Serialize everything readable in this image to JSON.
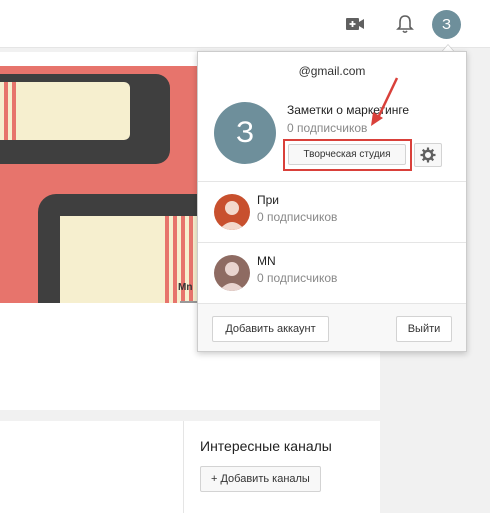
{
  "topbar": {
    "icons": [
      "video-upload-icon",
      "bell-icon"
    ],
    "avatar_letter": "З"
  },
  "banner": {
    "partial_label": "Mn"
  },
  "right_sidebar": {
    "title": "Интересные каналы",
    "add_button": "+ Добавить каналы"
  },
  "popup": {
    "email": "@gmail.com",
    "current_account": {
      "letter": "З",
      "name": "Заметки о маркетинге",
      "subscribers": "0 подписчиков",
      "studio_button": "Творческая студия",
      "highlight_color": "#d9403a"
    },
    "other_accounts": [
      {
        "name": "При",
        "subscribers": "0 подписчиков"
      },
      {
        "name": "MN",
        "subscribers": "0 подписчиков"
      }
    ],
    "add_account_button": "Добавить аккаунт",
    "logout_button": "Выйти"
  }
}
